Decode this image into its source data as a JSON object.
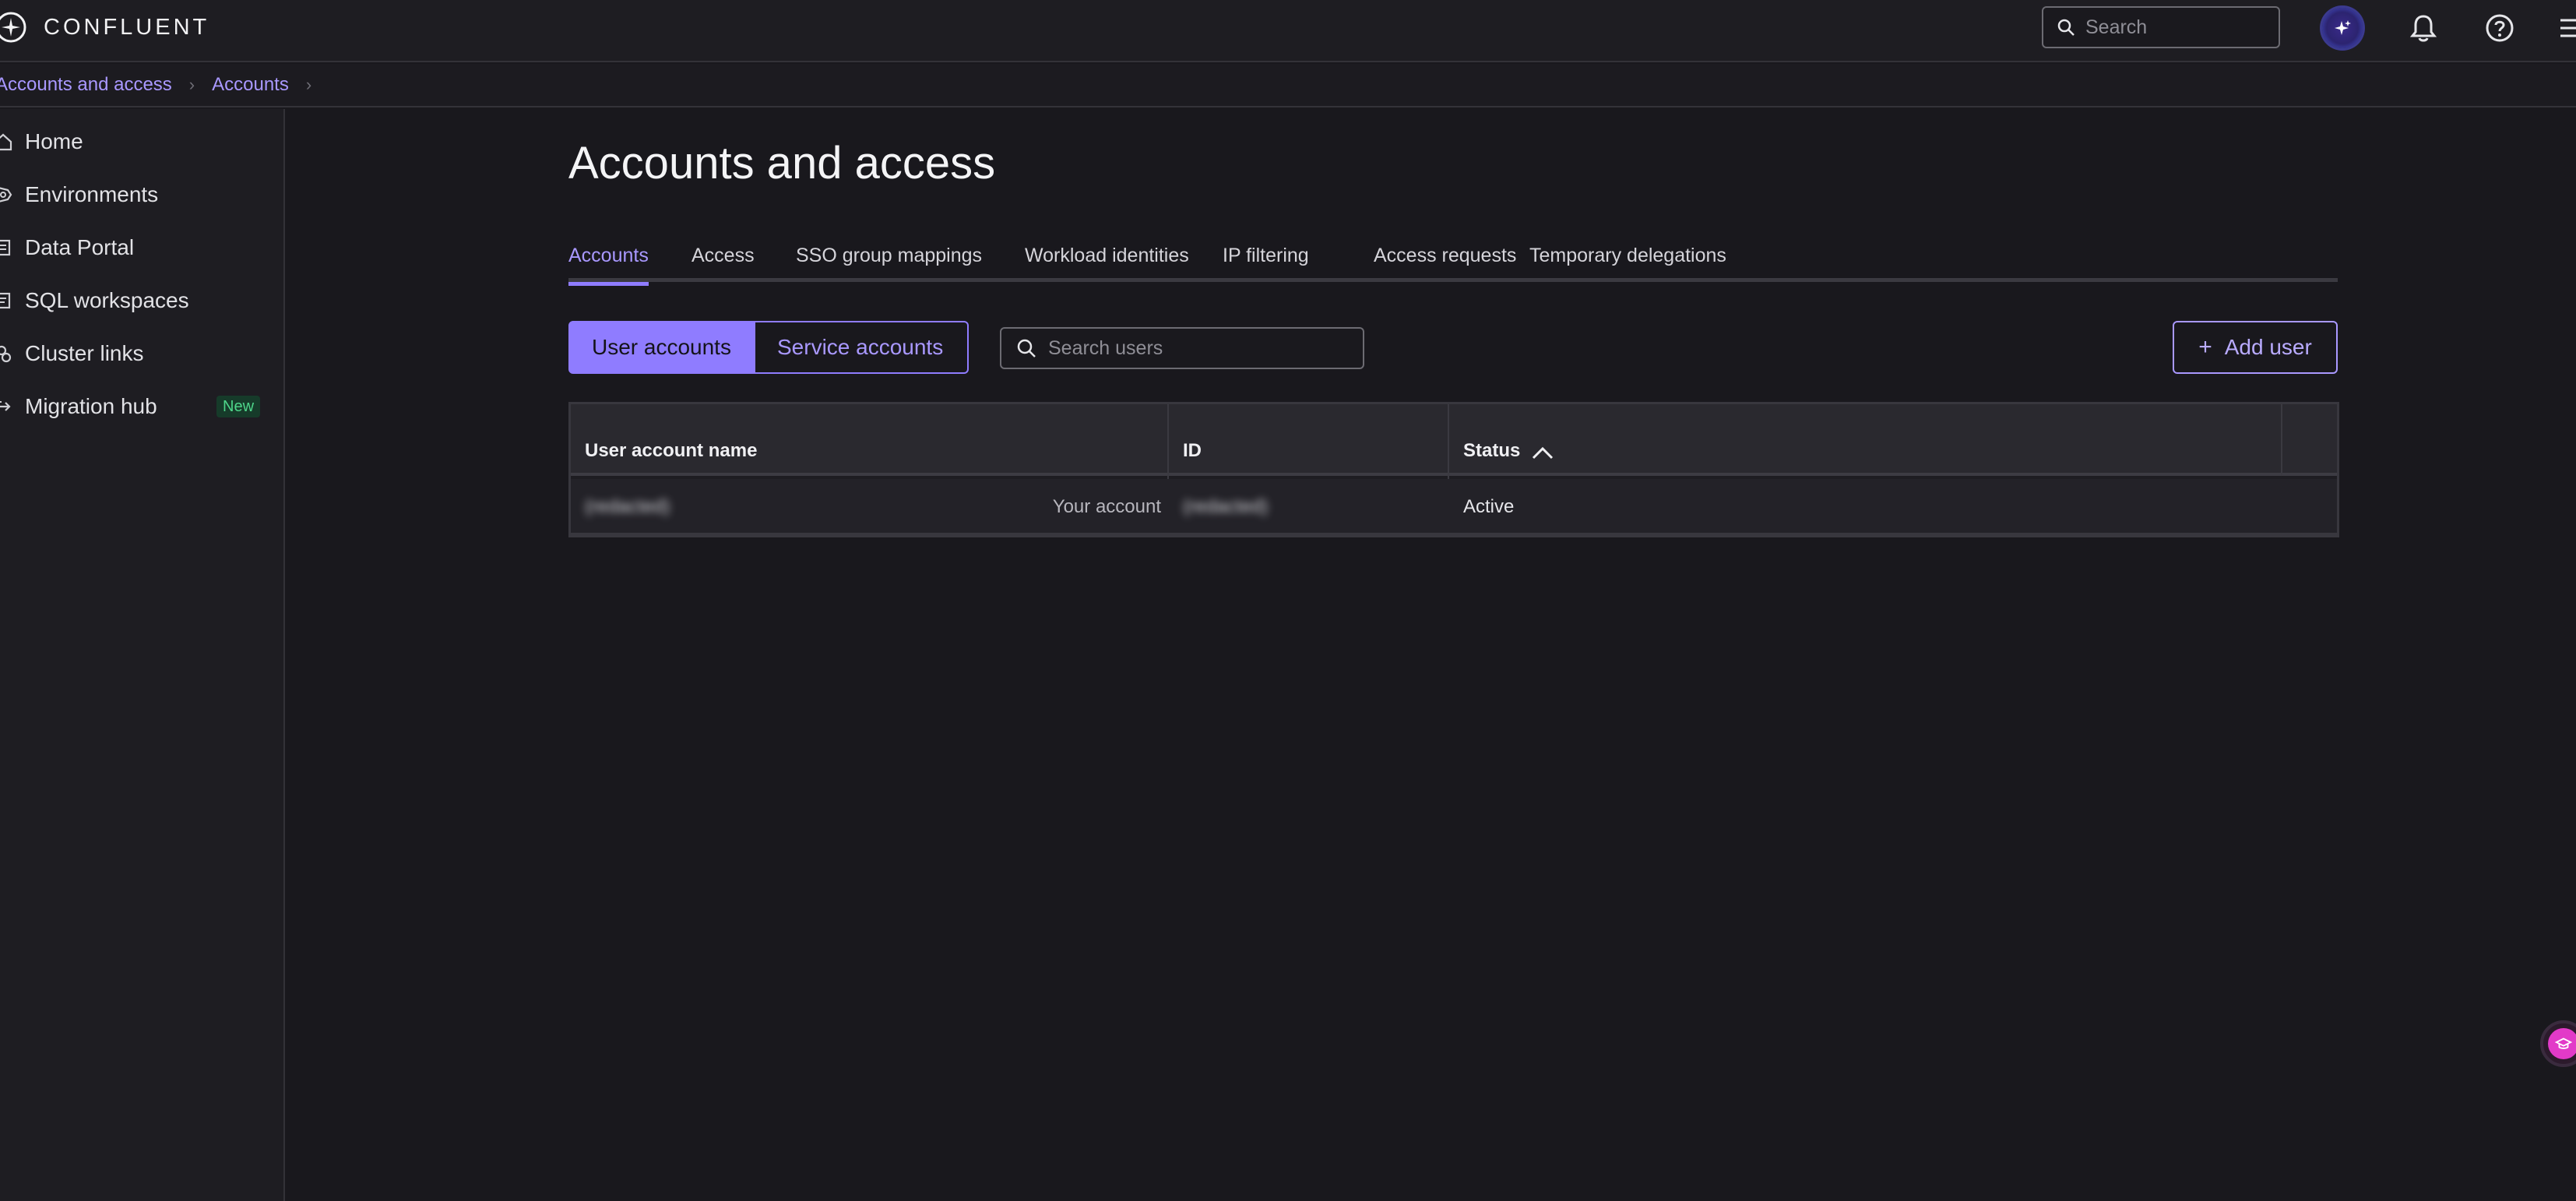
{
  "topbar": {
    "brand": "CONFLUENT",
    "search_placeholder": "Search",
    "icons": [
      "confluent-logo-icon",
      "search-icon",
      "ai-assistant-icon",
      "bell-icon",
      "help-icon",
      "menu-icon"
    ]
  },
  "breadcrumbs": [
    "Accounts and access",
    "Accounts"
  ],
  "sidebar": {
    "items": [
      {
        "label": "Home",
        "icon": "home-icon"
      },
      {
        "label": "Environments",
        "icon": "environments-icon"
      },
      {
        "label": "Data Portal",
        "icon": "data-portal-icon"
      },
      {
        "label": "SQL workspaces",
        "icon": "sql-icon"
      },
      {
        "label": "Cluster links",
        "icon": "link-icon"
      },
      {
        "label": "Migration hub",
        "icon": "migration-icon",
        "badge": "New"
      }
    ]
  },
  "main": {
    "title": "Accounts and access",
    "tabs": [
      {
        "label": "Accounts",
        "active": true
      },
      {
        "label": "Access"
      },
      {
        "label": "SSO group mappings"
      },
      {
        "label": "Workload identities"
      },
      {
        "label": "IP filtering"
      },
      {
        "label": "Access requests"
      },
      {
        "label": "Temporary delegations"
      }
    ],
    "segmented": {
      "user": "User accounts",
      "service": "Service accounts",
      "active": "User accounts"
    },
    "search_placeholder": "Search users",
    "add_user_label": "Add user",
    "table": {
      "columns": [
        "User account name",
        "ID",
        "Status"
      ],
      "sort": {
        "column": "Status",
        "direction": "ascending"
      },
      "rows": [
        {
          "name": "(redacted)",
          "tag": "Your account",
          "id": "(redacted)",
          "status": "Active"
        }
      ]
    }
  },
  "colors": {
    "accent": "#8f7cff",
    "accent_text": "#a998ff",
    "background": "#19181d",
    "new_badge": "#4ed58a",
    "help_fab": "#e23ac8"
  }
}
